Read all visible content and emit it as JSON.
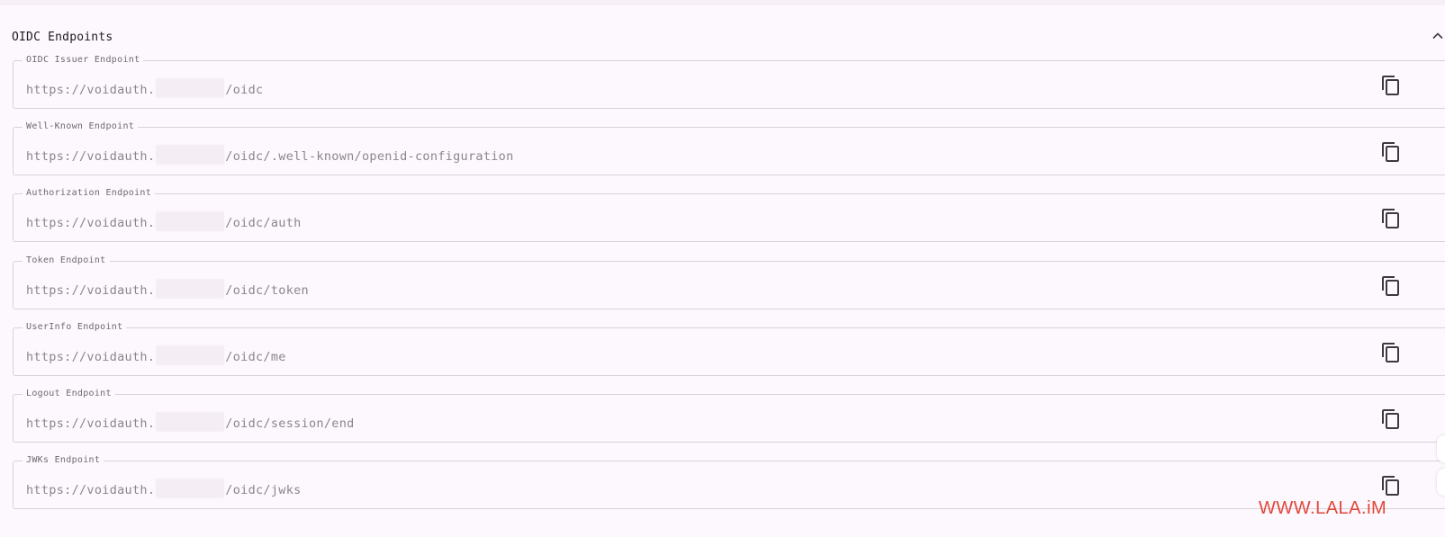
{
  "section": {
    "title": "OIDC Endpoints",
    "collapse_icon": "chevron-up-icon"
  },
  "fields": [
    {
      "label": "OIDC Issuer Endpoint",
      "prefix": "https://voidauth.",
      "suffix": "/oidc"
    },
    {
      "label": "Well-Known Endpoint",
      "prefix": "https://voidauth.",
      "suffix": "/oidc/.well-known/openid-configuration"
    },
    {
      "label": "Authorization Endpoint",
      "prefix": "https://voidauth.",
      "suffix": "/oidc/auth"
    },
    {
      "label": "Token Endpoint",
      "prefix": "https://voidauth.",
      "suffix": "/oidc/token"
    },
    {
      "label": "UserInfo Endpoint",
      "prefix": "https://voidauth.",
      "suffix": "/oidc/me"
    },
    {
      "label": "Logout Endpoint",
      "prefix": "https://voidauth.",
      "suffix": "/oidc/session/end"
    },
    {
      "label": "JWKs Endpoint",
      "prefix": "https://voidauth.",
      "suffix": "/oidc/jwks"
    }
  ],
  "copy_icon": "copy-icon",
  "watermark": "WWW.LALA.iM",
  "colors": {
    "background": "#fdf8fd",
    "border": "#d8d3d8",
    "value_text": "#8a868c",
    "label_text": "#6e6a70",
    "icon": "#3c3a3e",
    "watermark": "#e0483c"
  }
}
